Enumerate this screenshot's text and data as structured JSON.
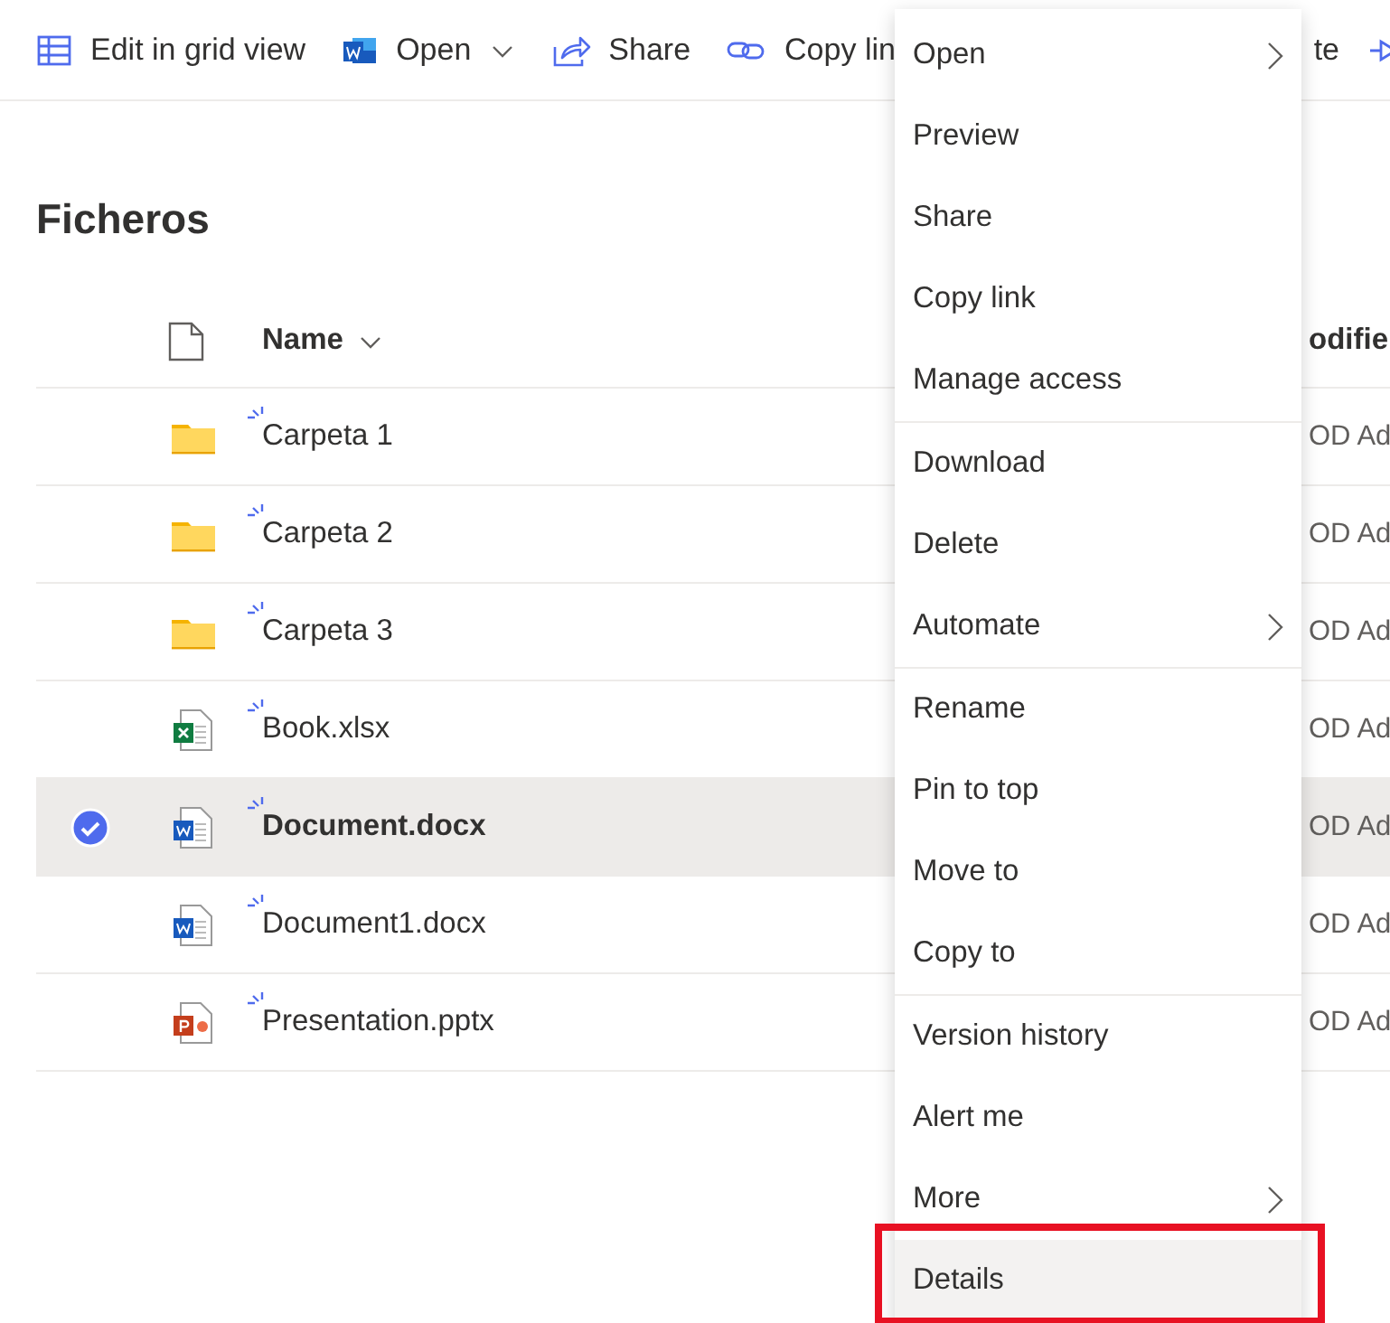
{
  "toolbar": [
    {
      "kind": "grid",
      "label": "Edit in grid view"
    },
    {
      "kind": "word",
      "label": "Open",
      "dropdown": true
    },
    {
      "kind": "share",
      "label": "Share"
    },
    {
      "kind": "link",
      "label": "Copy lin"
    },
    {
      "kind": "text",
      "label": "te"
    },
    {
      "kind": "arrow"
    }
  ],
  "page_title": "Ficheros",
  "list": {
    "columns": [
      "Name",
      "odifie"
    ],
    "rows": [
      {
        "name": "Carpeta 1",
        "kind": "folder",
        "new": true,
        "selected": false,
        "column_3": "OD Ad"
      },
      {
        "name": "Carpeta 2",
        "kind": "folder",
        "new": true,
        "selected": false,
        "column_3": "OD Ad"
      },
      {
        "name": "Carpeta 3",
        "kind": "folder",
        "new": true,
        "selected": false,
        "column_3": "OD Ad"
      },
      {
        "name": "Book.xlsx",
        "kind": "xlsx",
        "new": true,
        "selected": false,
        "column_3": "OD Ad"
      },
      {
        "name": "Document.docx",
        "kind": "docx",
        "new": true,
        "selected": true,
        "column_3": "OD Ad"
      },
      {
        "name": "Document1.docx",
        "kind": "docx",
        "new": true,
        "selected": false,
        "column_3": "OD Ad"
      },
      {
        "name": "Presentation.pptx",
        "kind": "pptx",
        "new": true,
        "selected": false,
        "column_3": "OD Ad"
      }
    ]
  },
  "context_menu": {
    "groups": [
      [
        {
          "label": "Open",
          "submenu": true,
          "highlighted": false
        },
        {
          "label": "Preview",
          "submenu": false,
          "highlighted": false
        },
        {
          "label": "Share",
          "submenu": false,
          "highlighted": false
        },
        {
          "label": "Copy link",
          "submenu": false,
          "highlighted": false
        },
        {
          "label": "Manage access",
          "submenu": false,
          "highlighted": false
        }
      ],
      [
        {
          "label": "Download",
          "submenu": false,
          "highlighted": false
        },
        {
          "label": "Delete",
          "submenu": false,
          "highlighted": false
        },
        {
          "label": "Automate",
          "submenu": true,
          "highlighted": false
        }
      ],
      [
        {
          "label": "Rename",
          "submenu": false,
          "highlighted": false
        },
        {
          "label": "Pin to top",
          "submenu": false,
          "highlighted": false
        },
        {
          "label": "Move to",
          "submenu": false,
          "highlighted": false
        },
        {
          "label": "Copy to",
          "submenu": false,
          "highlighted": false
        }
      ],
      [
        {
          "label": "Version history",
          "submenu": false,
          "highlighted": false
        },
        {
          "label": "Alert me",
          "submenu": false,
          "highlighted": false
        },
        {
          "label": "More",
          "submenu": true,
          "highlighted": false
        },
        {
          "label": "Details",
          "submenu": false,
          "highlighted": true,
          "annotated": true
        }
      ]
    ]
  }
}
